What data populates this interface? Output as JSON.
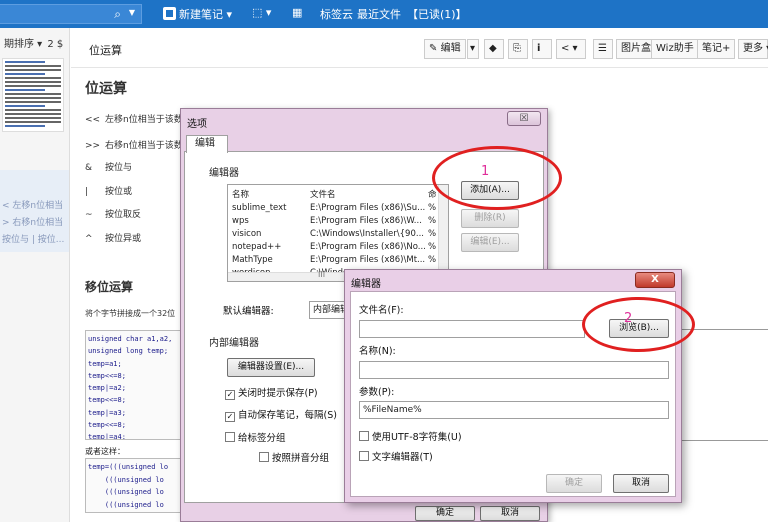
{
  "topbar": {
    "new_note": "新建笔记",
    "tags_cloud": "标签云",
    "recent_files": "最近文件",
    "read_count": "【已读(1)】"
  },
  "sidebar": {
    "sort_label": "期排序 ▾",
    "page_num": "2 $",
    "selected_preview": [
      "< 左移n位相当",
      "> 右移n位相当",
      "按位与 | 按位..."
    ]
  },
  "note": {
    "bar_title": "位运算",
    "toolbar": [
      "编辑",
      "图片盒",
      "Wiz助手",
      "笔记+",
      "更多"
    ],
    "heading": "位运算",
    "ops": [
      {
        "op": "<<",
        "text": "左移n位相当于该数"
      },
      {
        "op": ">>",
        "text": "右移n位相当于该数"
      },
      {
        "op": "&",
        "text": "按位与"
      },
      {
        "op": "|",
        "text": "按位或"
      },
      {
        "op": "~",
        "text": "按位取反"
      },
      {
        "op": "^",
        "text": "按位异或"
      }
    ],
    "heading2": "移位运算",
    "desc": "将个字节拼接成一个32位",
    "code_lines": [
      "unsigned char a1,a2,",
      "unsigned long temp;",
      "temp=a1;",
      "temp<<=8;",
      "temp|=a2;",
      "temp<<=8;",
      "temp|=a3;",
      "temp<<=8;",
      "temp|=a4;"
    ],
    "or_text": "或者这样：",
    "code2_lines": [
      "temp=(((unsigned lo",
      "    (((unsigned lo",
      "    (((unsigned lo",
      "    (((unsigned lo"
    ]
  },
  "options_dialog": {
    "title": "选项",
    "close": "☒",
    "tab": "编辑",
    "group_editors": "编辑器",
    "columns": [
      "名称",
      "文件名",
      "命"
    ],
    "rows": [
      {
        "name": "sublime_text",
        "file": "E:\\Program Files (x86)\\Su...",
        "cmd": "%"
      },
      {
        "name": "wps",
        "file": "E:\\Program Files (x86)\\W...",
        "cmd": "%"
      },
      {
        "name": "visicon",
        "file": "C:\\Windows\\Installer\\{90...",
        "cmd": "%"
      },
      {
        "name": "notepad++",
        "file": "E:\\Program Files (x86)\\No...",
        "cmd": "%"
      },
      {
        "name": "MathType",
        "file": "E:\\Program Files (x86)\\Mt...",
        "cmd": "%"
      },
      {
        "name": "wordicon",
        "file": "C:\\Windo...",
        "cmd": ""
      }
    ],
    "add_button": "添加(A)...",
    "delete_button": "删除(R)",
    "edit_button": "编辑(E)...",
    "default_editor_label": "默认编辑器:",
    "default_editor_value": "内部编辑",
    "group_internal": "内部编辑器",
    "editor_settings_button": "编辑器设置(E)...",
    "check_close_save": "关闭时提示保存(P)",
    "check_autosave": "自动保存笔记，每隔(S)",
    "check_tag_group": "给标签分组",
    "check_pinyin_group": "按照拼音分组",
    "ok_button": "确定",
    "cancel_button": "取消"
  },
  "editor_dialog": {
    "title": "编辑器",
    "close": "X",
    "filename_label": "文件名(F):",
    "filename_value": "",
    "browse_button": "浏览(B)...",
    "name_label": "名称(N):",
    "name_value": "",
    "params_label": "参数(P):",
    "params_value": "%FileName%",
    "check_utf8": "使用UTF-8字符集(U)",
    "check_text_editor": "文字编辑器(T)",
    "ok_button": "确定",
    "cancel_button": "取消"
  },
  "annotations": {
    "num1": "1",
    "num2": "2",
    "color": "#e02020"
  }
}
